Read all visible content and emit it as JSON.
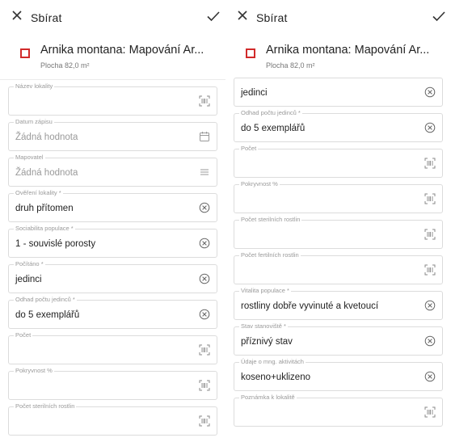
{
  "header": {
    "title": "Sbírat"
  },
  "project": {
    "name": "Arnika montana: Mapování Ar...",
    "area": "Plocha 82,0 m²",
    "color": "#d12a2a"
  },
  "left_fields": [
    {
      "label": "Název lokality",
      "value": "",
      "icon": "scan-icon"
    },
    {
      "label": "Datum zápisu",
      "value": "Žádná hodnota",
      "icon": "calendar-icon"
    },
    {
      "label": "Mapovatel",
      "value": "Žádná hodnota",
      "icon": "list-icon"
    },
    {
      "label": "Ověření lokality *",
      "value": "druh přítomen",
      "icon": "clear-icon"
    },
    {
      "label": "Sociabilita populace *",
      "value": "1 - souvislé porosty",
      "icon": "clear-icon"
    },
    {
      "label": "Počítáno *",
      "value": "jedinci",
      "icon": "clear-icon"
    },
    {
      "label": "Odhad počtu jedinců *",
      "value": "do 5 exemplářů",
      "icon": "clear-icon"
    },
    {
      "label": "Počet",
      "value": "",
      "icon": "scan-icon"
    },
    {
      "label": "Pokryvnost %",
      "value": "",
      "icon": "scan-icon"
    },
    {
      "label": "Počet sterilních rostlin",
      "value": "",
      "icon": "scan-icon"
    }
  ],
  "right_fields": [
    {
      "label": "",
      "value": "jedinci",
      "icon": "clear-icon"
    },
    {
      "label": "Odhad počtu jedinců *",
      "value": "do 5 exemplářů",
      "icon": "clear-icon"
    },
    {
      "label": "Počet",
      "value": "",
      "icon": "scan-icon"
    },
    {
      "label": "Pokryvnost %",
      "value": "",
      "icon": "scan-icon"
    },
    {
      "label": "Počet sterilních rostlin",
      "value": "",
      "icon": "scan-icon"
    },
    {
      "label": "Počet fertilních rostlin",
      "value": "",
      "icon": "scan-icon"
    },
    {
      "label": "Vitalita populace *",
      "value": "rostliny dobře vyvinuté a kvetoucí",
      "icon": "clear-icon"
    },
    {
      "label": "Stav stanoviště *",
      "value": "příznivý stav",
      "icon": "clear-icon"
    },
    {
      "label": "Údaje o mng. aktivitách",
      "value": "koseno+uklizeno",
      "icon": "clear-icon"
    },
    {
      "label": "Poznámka k lokalitě",
      "value": "",
      "icon": "scan-icon"
    }
  ]
}
